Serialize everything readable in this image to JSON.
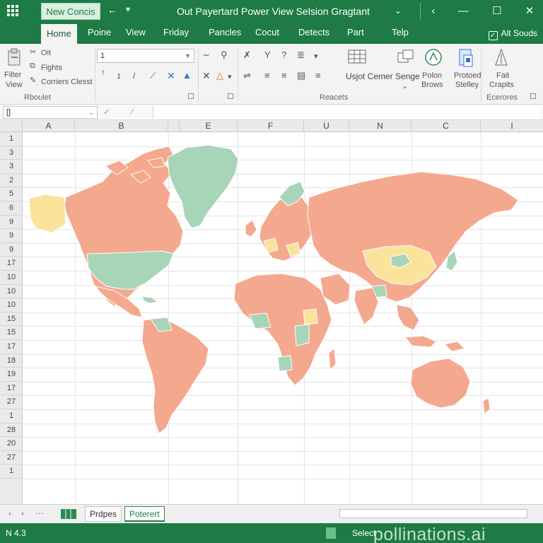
{
  "window": {
    "doc_button": "New Concis",
    "title": "Out Payertard Power View Selsion Gragtant",
    "controls": {
      "minimize": "—",
      "maximize": "☐",
      "close": "✕"
    }
  },
  "tabs": [
    "Home",
    "Poine",
    "View",
    "Friday",
    "Pancles",
    "Cocut",
    "Detects",
    "Part",
    "Telp"
  ],
  "share_label": "Alt Souds",
  "ribbon": {
    "filter_view_line1": "Filter",
    "filter_view_line2": "View",
    "clipboard_items": [
      "Oit",
      "Fights",
      "Corriers Clesst"
    ],
    "clipboard_group": "Rboulet",
    "font_value": "1",
    "insert_label": "Usjot Cemer Senge",
    "polon_line1": "Polon",
    "polon_line2": "Brows",
    "protoed_line1": "Protoed",
    "protoed_line2": "Stelley",
    "fait_line1": "Fait",
    "fait_line2": "Crapits",
    "group_reacets": "Reacets",
    "group_ecerores": "Ecerores"
  },
  "formula_bar": {
    "name_box": "[]"
  },
  "columns": [
    "A",
    "B",
    "",
    "E",
    "F",
    "U",
    "N",
    "C",
    "I"
  ],
  "rows": [
    "1",
    "3",
    "3",
    "2",
    "5",
    "6",
    "9",
    "9",
    "9",
    "17",
    "10",
    "10",
    "10",
    "15",
    "15",
    "17",
    "18",
    "19",
    "17",
    "27",
    "1",
    "28",
    "20",
    "27",
    "1"
  ],
  "sheets": {
    "nav_prev": "‹",
    "nav_next": "›",
    "nav_more": "⋯",
    "tabs": [
      "Prdpes",
      "Poterert"
    ],
    "active": "Poterert"
  },
  "status": {
    "left": "N  4.3",
    "right": "Select"
  },
  "watermark": "pollinations.ai",
  "colors": {
    "brand_green": "#1e7b45",
    "map_orange": "#f4a88e",
    "map_green": "#a8d5b8",
    "map_yellow": "#fbe39c"
  },
  "icons": [
    "app-grid-icon",
    "undo-icon",
    "paste-icon",
    "cut-icon",
    "copy-icon",
    "format-painter-icon",
    "bold-icon",
    "italic-icon",
    "filter-icon",
    "question-icon",
    "align-icon",
    "table-icon",
    "shape-icon",
    "chart-icon",
    "select-icon",
    "checkbox-icon"
  ]
}
